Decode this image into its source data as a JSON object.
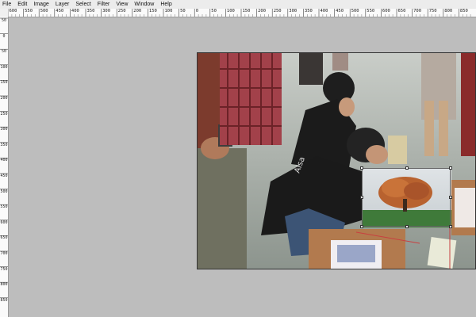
{
  "menu": {
    "items": [
      "File",
      "Edit",
      "Image",
      "Layer",
      "Select",
      "Filter",
      "View",
      "Window",
      "Help"
    ]
  },
  "ruler": {
    "horizontal_labels": [
      "600",
      "550",
      "500",
      "450",
      "400",
      "350",
      "300",
      "250",
      "200",
      "150",
      "100",
      "50",
      "0",
      "50",
      "100",
      "150",
      "200",
      "250",
      "300",
      "350",
      "400",
      "450",
      "500",
      "550",
      "600",
      "650",
      "700",
      "750",
      "800",
      "850"
    ],
    "vertical_labels": [
      "50",
      "0",
      "50",
      "100",
      "150",
      "200",
      "250",
      "300",
      "350",
      "400",
      "450",
      "500",
      "550",
      "600",
      "650",
      "700",
      "750",
      "800",
      "850"
    ]
  },
  "canvas": {
    "background_color": "#bdbdbd",
    "photo_subject": "people crouching on a plaza with framed art; inserted tree photograph with transform selection"
  },
  "colors": {
    "menubar": "#ececec",
    "ruler": "#fafafa",
    "workspace": "#bdbdbd"
  }
}
